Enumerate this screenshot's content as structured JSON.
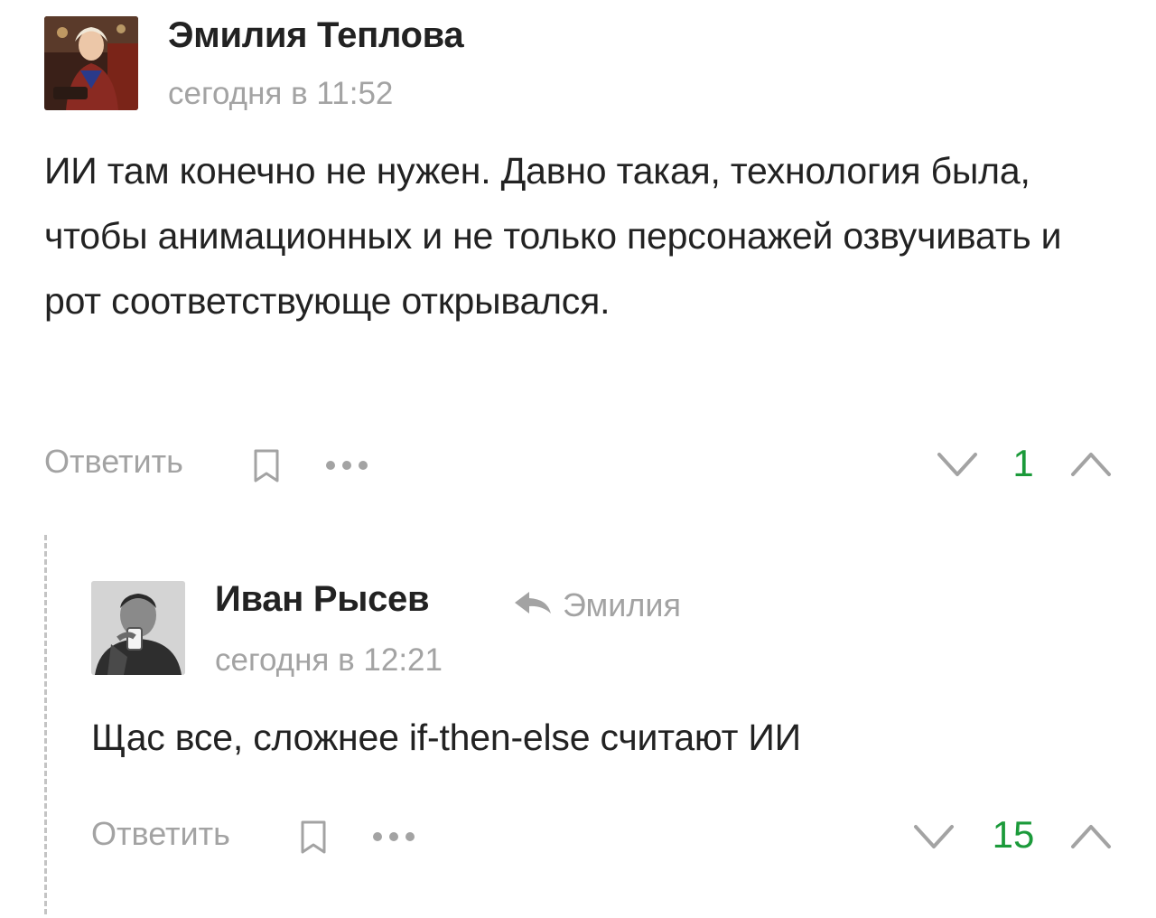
{
  "comments": [
    {
      "author": "Эмилия Теплова",
      "time": "сегодня в 11:52",
      "text": "ИИ там конечно не нужен. Давно такая, технология была, чтобы анимационных и не только персонажей озвучивать и рот соответствующе открывался.",
      "reply_label": "Ответить",
      "rating": "1",
      "avatar_icon": "woman-photo-avatar"
    },
    {
      "author": "Иван Рысев",
      "reply_to": "Эмилия",
      "time": "сегодня в 12:21",
      "text": "Щас все, сложнее if-then-else считают ИИ",
      "reply_label": "Ответить",
      "rating": "15",
      "avatar_icon": "man-photo-avatar"
    }
  ],
  "colors": {
    "text": "#222222",
    "muted": "#a3a3a3",
    "rating_positive": "#1b9a3a",
    "thread_line": "#c4c4c4"
  },
  "icons": {
    "bookmark": "bookmark-icon",
    "more": "more-dots-icon",
    "downvote": "chevron-down-icon",
    "upvote": "chevron-up-icon",
    "reply_arrow": "reply-arrow-icon"
  }
}
